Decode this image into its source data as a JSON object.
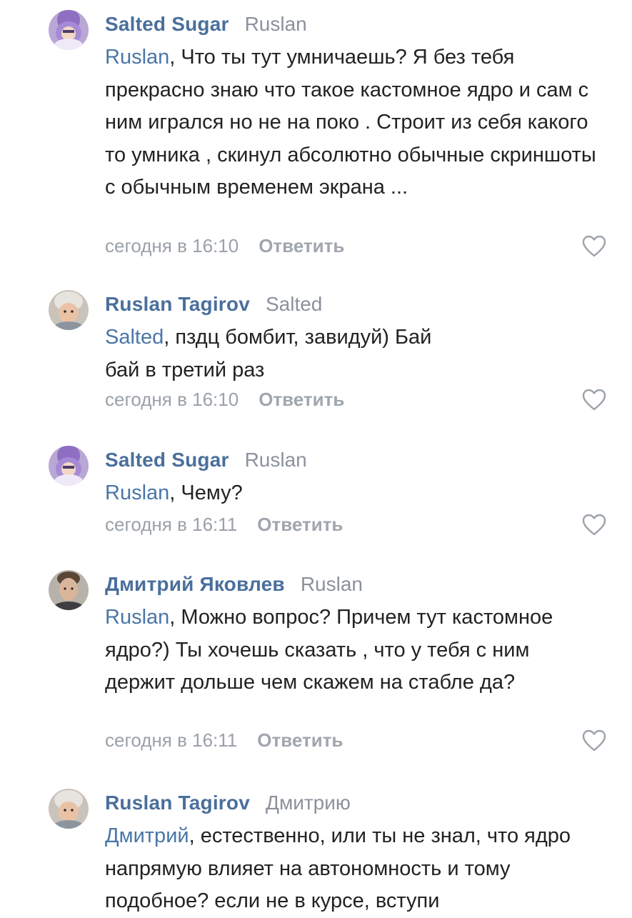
{
  "colors": {
    "author": "#4a6f9c",
    "mention": "#4a76a8",
    "muted": "#9aa1a9",
    "text": "#222222"
  },
  "comments": [
    {
      "author": "Salted Sugar",
      "reply_to": "Ruslan",
      "avatar_icon": "purple-hooded-avatar",
      "mention": "Ruslan",
      "text": ", Что ты тут умничаешь? Я без тебя прекрасно знаю что такое кастомное ядро и сам с ним игрался но не на поко . Строит из себя какого то умника , скинул абсолютно обычные скриншоты с обычным временем экрана ...",
      "time": "сегодня в 16:10",
      "reply_label": "Ответить",
      "like_icon": "heart-outline-icon"
    },
    {
      "author": "Ruslan Tagirov",
      "reply_to": "Salted",
      "avatar_icon": "baby-photo-avatar",
      "mention": "Salted",
      "text": ", пздц бомбит, завидуй) Бай бай в третий раз",
      "time": "сегодня в 16:10",
      "reply_label": "Ответить",
      "like_icon": "heart-outline-icon"
    },
    {
      "author": "Salted Sugar",
      "reply_to": "Ruslan",
      "avatar_icon": "purple-hooded-avatar",
      "mention": "Ruslan",
      "text": ", Чему?",
      "time": "сегодня в 16:11",
      "reply_label": "Ответить",
      "like_icon": "heart-outline-icon"
    },
    {
      "author": "Дмитрий Яковлев",
      "reply_to": "Ruslan",
      "avatar_icon": "man-photo-avatar",
      "mention": "Ruslan",
      "text": ", Можно вопрос? Причем тут кастомное ядро?) Ты хочешь сказать , что у тебя с ним держит дольше чем скажем на стабле да?",
      "time": "сегодня в 16:11",
      "reply_label": "Ответить",
      "like_icon": "heart-outline-icon"
    },
    {
      "author": "Ruslan Tagirov",
      "reply_to": "Дмитрию",
      "avatar_icon": "baby-photo-avatar",
      "mention": "Дмитрий",
      "text": ", естественно, или ты не знал, что ядро напрямую влияет на автономность и тому подобное? если не в курсе, вступи"
    }
  ]
}
